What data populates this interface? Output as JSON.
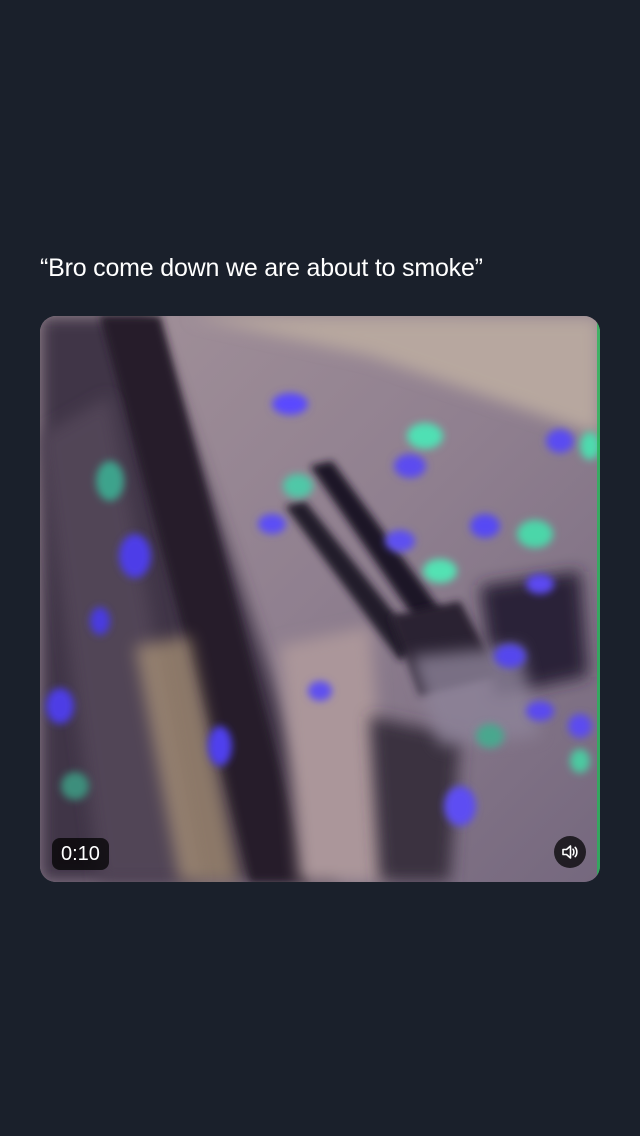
{
  "post": {
    "text": "“Bro come down we are about to smoke”"
  },
  "video": {
    "duration_label": "0:10",
    "sound_icon": "speaker-icon"
  }
}
